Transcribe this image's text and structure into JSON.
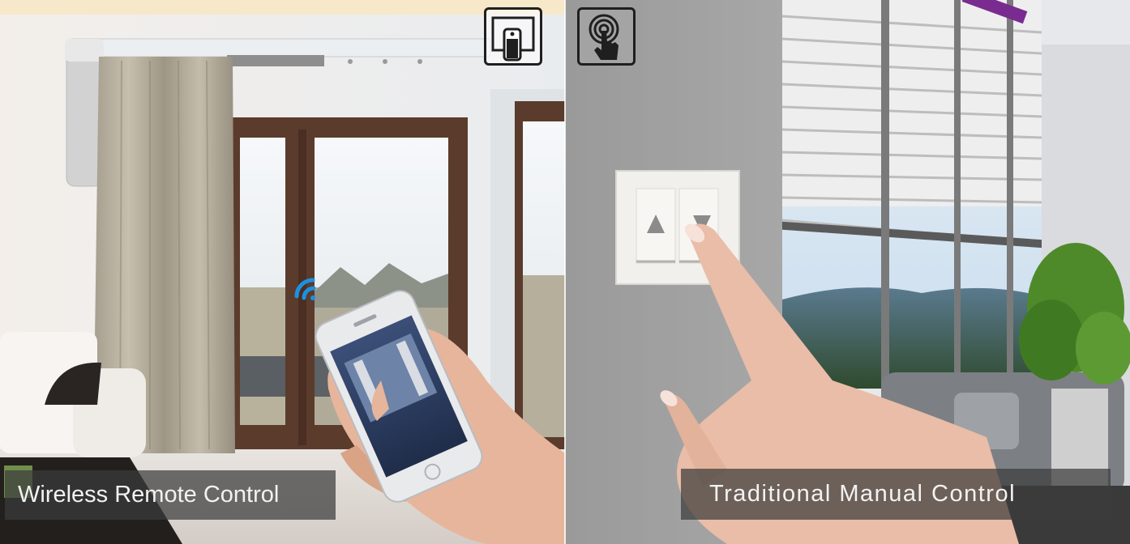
{
  "left_panel": {
    "caption": "Wireless Remote Control",
    "badge_icon": "remote-control-icon",
    "phone_screen": "curtain control app"
  },
  "right_panel": {
    "caption": "Traditional Manual Control",
    "badge_icon": "touch-finger-icon",
    "switch_buttons": [
      "up-arrow-icon",
      "down-arrow-icon"
    ]
  },
  "colors": {
    "caption_bg": "#3c3c3c",
    "wifi_blue": "#1e90e0",
    "wall_gray": "#9d9d9d"
  }
}
